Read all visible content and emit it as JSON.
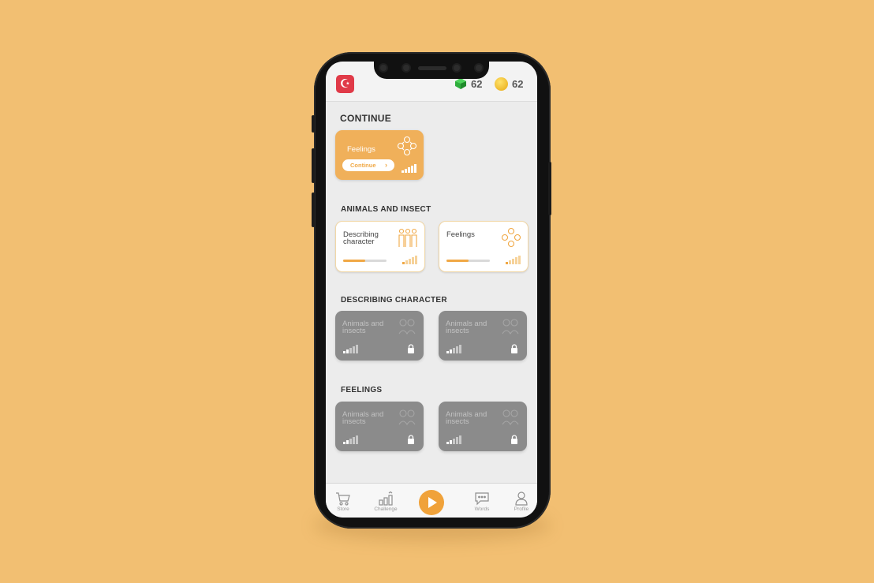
{
  "header": {
    "flag_icon": "turkey-flag-icon",
    "gems": "62",
    "coins": "62"
  },
  "continue_section": {
    "title": "CONTINUE",
    "card": {
      "title": "Feelings",
      "button": "Continue",
      "icon": "emotions-icon"
    }
  },
  "sections": [
    {
      "title": "ANIMALS AND INSECT",
      "cards": [
        {
          "title": "Describing character",
          "progress": 0.5,
          "locked": false,
          "icon": "people-icon"
        },
        {
          "title": "Feelings",
          "progress": 0.5,
          "locked": false,
          "icon": "emotions-icon"
        }
      ]
    },
    {
      "title": "DESCRIBING CHARACTER",
      "cards": [
        {
          "title": "Animals and insects",
          "locked": true,
          "icon": "animals-icon"
        },
        {
          "title": "Animals and insects",
          "locked": true,
          "icon": "animals-icon"
        }
      ]
    },
    {
      "title": "FEELINGS",
      "cards": [
        {
          "title": "Animals and insects",
          "locked": true,
          "icon": "animals-icon"
        },
        {
          "title": "Animals and insects",
          "locked": true,
          "icon": "animals-icon"
        }
      ]
    }
  ],
  "nav": {
    "store": "Store",
    "challenge": "Challenge",
    "words": "Words",
    "profile": "Profile"
  },
  "colors": {
    "accent": "#f0a845",
    "background": "#f2bf72",
    "locked_card": "#8b8b8b"
  }
}
